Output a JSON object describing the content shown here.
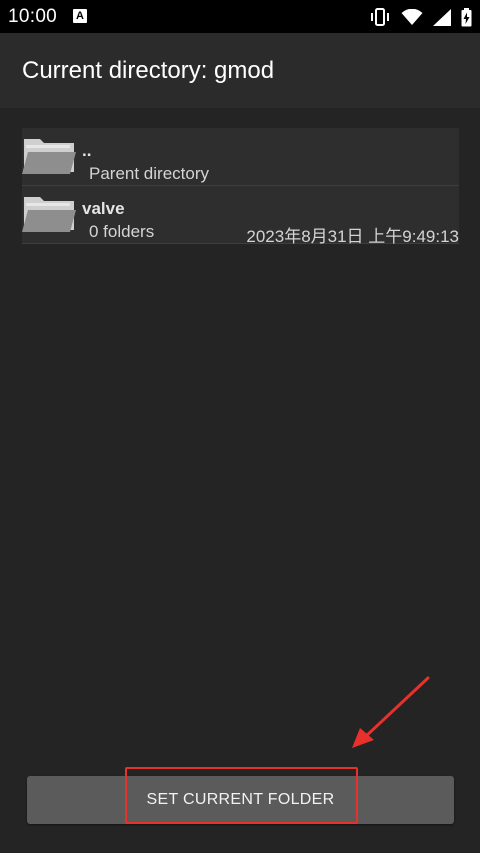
{
  "status_bar": {
    "time": "10:00",
    "notification_badge": "A",
    "icons": [
      "vibrate-icon",
      "wifi-icon",
      "signal-icon",
      "battery-charging-icon"
    ]
  },
  "header": {
    "title": "Current directory: gmod"
  },
  "file_list": [
    {
      "name": "..",
      "subtitle": "Parent directory",
      "date": "",
      "icon": "folder-icon"
    },
    {
      "name": "valve",
      "subtitle": "0 folders",
      "date": "2023年8月31日 上午9:49:13",
      "icon": "folder-icon"
    }
  ],
  "actions": {
    "set_current_folder_label": "SET CURRENT FOLDER"
  },
  "colors": {
    "background": "#242424",
    "header": "#2b2b2b",
    "row": "#2e2e2e",
    "button": "#5b5b5b",
    "annotation": "#e8302c"
  }
}
